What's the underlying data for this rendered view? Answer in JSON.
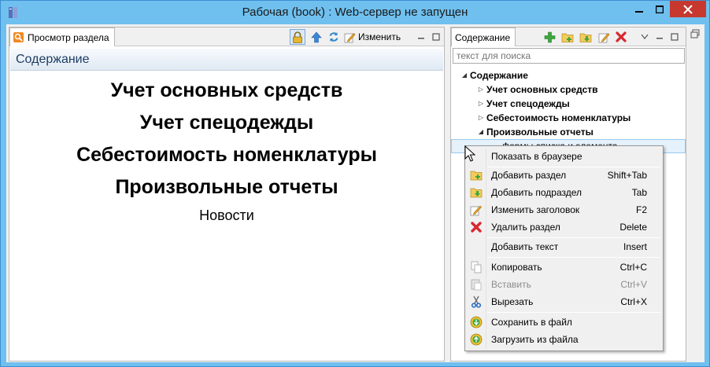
{
  "window": {
    "title": "Рабочая (book) : Web-сервер не запущен"
  },
  "left_panel": {
    "tab_label": "Просмотр раздела",
    "edit_label": "Изменить",
    "section_header": "Содержание",
    "content_items": [
      "Учет основных средств",
      "Учет спецодежды",
      "Себестоимость номенклатуры",
      "Произвольные отчеты"
    ],
    "news_link": "Новости"
  },
  "right_panel": {
    "tab_label": "Содержание",
    "search_placeholder": "текст для поиска",
    "tree": {
      "root": "Содержание",
      "children": [
        "Учет основных средств",
        "Учет спецодежды",
        "Себестоимость номенклатуры",
        "Произвольные отчеты"
      ],
      "selected_child": "Формы списка и элемента"
    }
  },
  "context_menu": {
    "items": [
      {
        "label": "Показать в браузере",
        "shortcut": ""
      },
      {
        "label": "Добавить раздел",
        "shortcut": "Shift+Tab"
      },
      {
        "label": "Добавить подраздел",
        "shortcut": "Tab"
      },
      {
        "label": "Изменить заголовок",
        "shortcut": "F2"
      },
      {
        "label": "Удалить раздел",
        "shortcut": "Delete"
      },
      {
        "label": "Добавить текст",
        "shortcut": "Insert"
      },
      {
        "label": "Копировать",
        "shortcut": "Ctrl+C"
      },
      {
        "label": "Вставить",
        "shortcut": "Ctrl+V"
      },
      {
        "label": "Вырезать",
        "shortcut": "Ctrl+X"
      },
      {
        "label": "Сохранить в файл",
        "shortcut": ""
      },
      {
        "label": "Загрузить из файла",
        "shortcut": ""
      }
    ]
  },
  "colors": {
    "title_bar": "#6fc0ef",
    "close_button": "#c7382f",
    "header_text": "#1d3d63",
    "selection": "#e5f1fb",
    "delete_red": "#d9282f",
    "add_green": "#3ea53e"
  }
}
